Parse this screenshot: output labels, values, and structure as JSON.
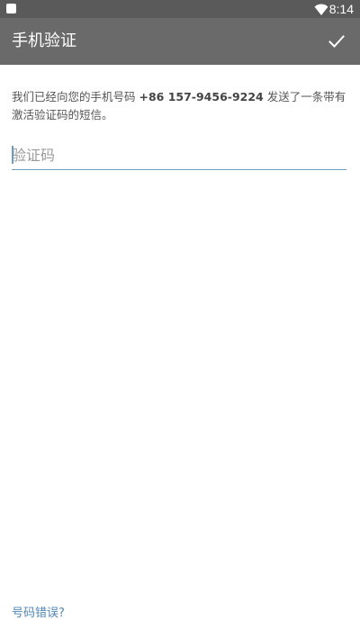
{
  "status_bar": {
    "time": "8:14",
    "left_icon": "notification-icon",
    "right_icon": "wifi-icon"
  },
  "app_bar": {
    "title": "手机验证",
    "confirm_icon": "checkmark-icon"
  },
  "message": {
    "prefix": "我们已经向您的手机号码 ",
    "phone": "+86 157-9456-9224",
    "suffix": " 发送了一条带有激活验证码的短信。"
  },
  "code_input": {
    "value": "",
    "placeholder": "验证码"
  },
  "wrong_number_link": "号码错误?",
  "colors": {
    "status_bar": "#5a5a5a",
    "app_bar": "#6a6a6a",
    "accent": "#6c9ebf",
    "link": "#4f86b5"
  }
}
